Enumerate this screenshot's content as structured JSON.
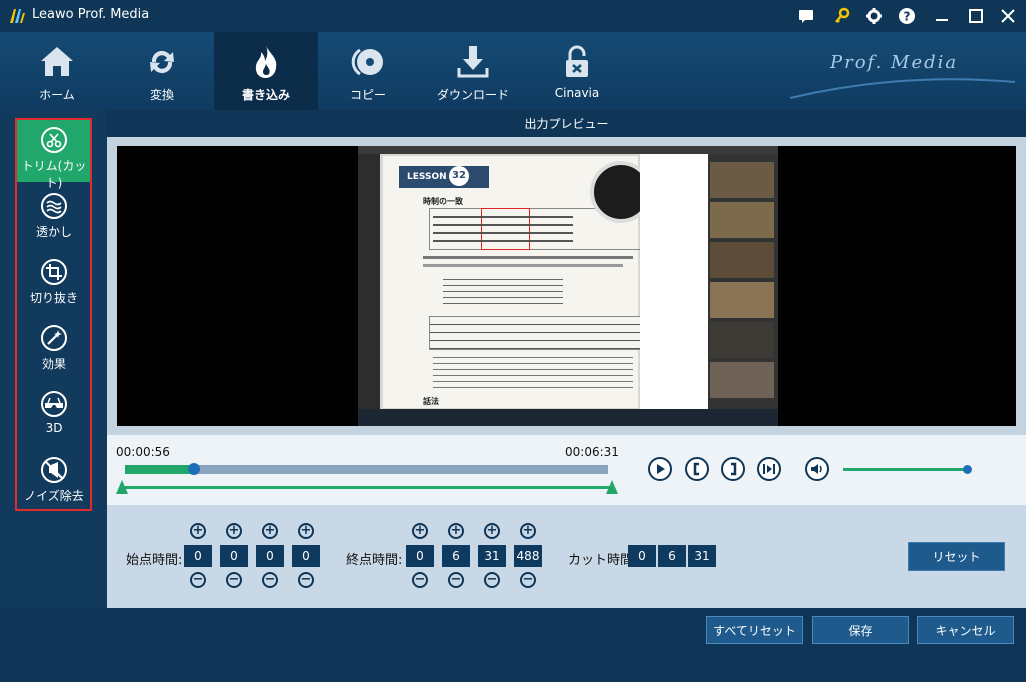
{
  "window": {
    "title": "Leawo Prof. Media",
    "brand": "Prof. Media"
  },
  "nav": {
    "items": [
      {
        "label": "ホーム",
        "icon": "home-icon"
      },
      {
        "label": "変換",
        "icon": "convert-icon"
      },
      {
        "label": "書き込み",
        "icon": "burn-icon",
        "active": true
      },
      {
        "label": "コピー",
        "icon": "copy-disc-icon"
      },
      {
        "label": "ダウンロード",
        "icon": "download-icon"
      },
      {
        "label": "Cinavia",
        "icon": "cinavia-lock-icon"
      }
    ]
  },
  "sidebar": {
    "items": [
      {
        "label": "トリム(カット)",
        "icon": "scissors-icon",
        "active": true
      },
      {
        "label": "透かし",
        "icon": "watermark-icon"
      },
      {
        "label": "切り抜き",
        "icon": "crop-icon"
      },
      {
        "label": "効果",
        "icon": "effect-icon"
      },
      {
        "label": "3D",
        "icon": "3d-glasses-icon"
      },
      {
        "label": "ノイズ除去",
        "icon": "noise-remove-icon"
      }
    ]
  },
  "preview": {
    "title": "出力プレビュー",
    "lesson_label": "LESSON",
    "lesson_number": "32",
    "section_heading": "時制の一致",
    "section_2": "話法"
  },
  "timeline": {
    "current_time": "00:00:56",
    "total_time": "00:06:31",
    "progress": 0.143
  },
  "trim": {
    "start_label": "始点時間:",
    "start_values": [
      "0",
      "0",
      "0",
      "0"
    ],
    "end_label": "終点時間:",
    "end_values": [
      "0",
      "6",
      "31",
      "488"
    ],
    "cut_label": "カット時間:",
    "cut_values": [
      "0",
      "6",
      "31"
    ],
    "reset_label": "リセット"
  },
  "footer": {
    "reset_all_label": "すべてリセット",
    "save_label": "保存",
    "cancel_label": "キャンセル"
  },
  "colors": {
    "accent_green": "#21a76b",
    "dark_blue": "#0f3657",
    "highlight_red": "#e12b2b"
  }
}
